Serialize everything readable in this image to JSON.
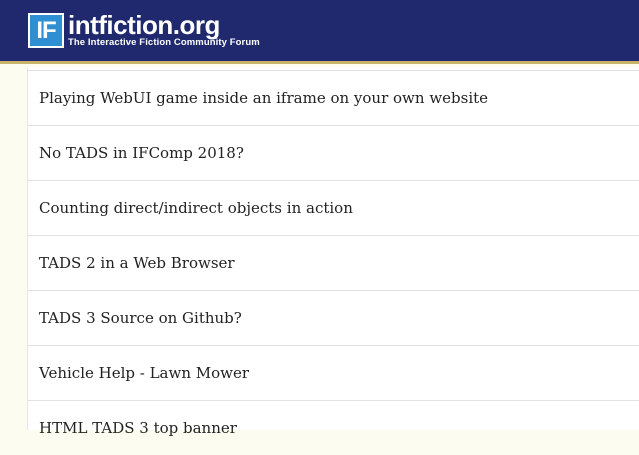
{
  "header": {
    "logo_mark": "IF",
    "logo_name": "intfiction.org",
    "logo_tagline": "The Interactive Fiction Community Forum"
  },
  "topics": [
    "Playing WebUI game inside an iframe on your own website",
    "No TADS in IFComp 2018?",
    "Counting direct/indirect objects in action",
    "TADS 2 in a Web Browser",
    "TADS 3 Source on Github?",
    "Vehicle Help - Lawn Mower",
    "HTML TADS 3 top banner"
  ]
}
